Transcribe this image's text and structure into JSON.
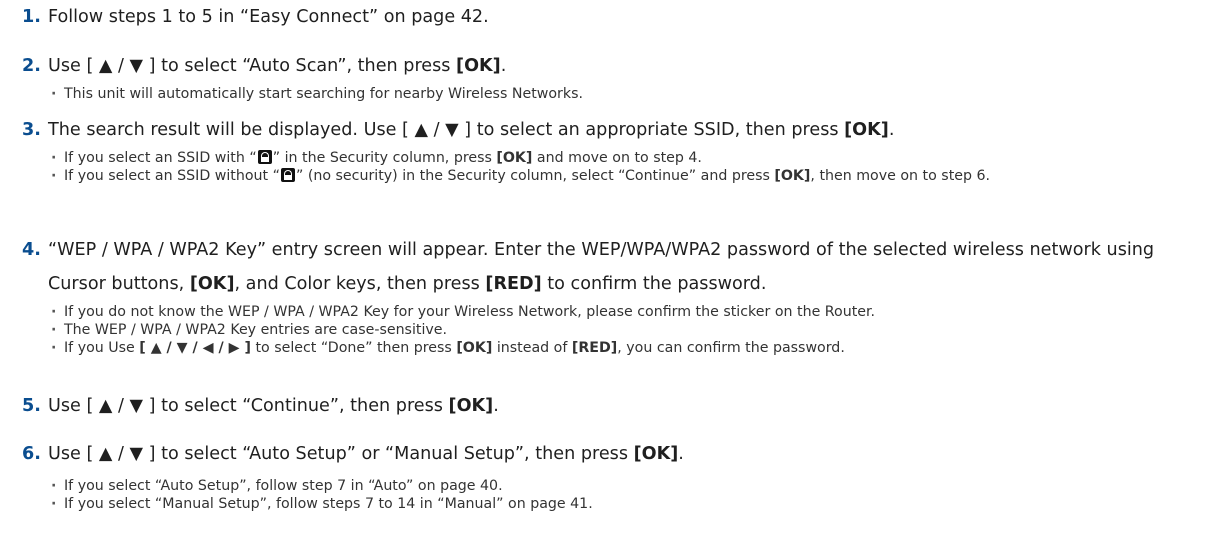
{
  "steps": [
    {
      "num": "1.",
      "text": "Follow steps 1 to 5 in “Easy Connect” on page 42."
    },
    {
      "num": "2.",
      "text_before": "Use [ ▲ / ▼ ] to select “Auto Scan”, then press ",
      "key": "[OK]",
      "text_after": ".",
      "bullets": [
        "This unit will automatically start searching for nearby Wireless Networks."
      ]
    },
    {
      "num": "3.",
      "text_before": "The search result will be displayed. Use [ ▲ / ▼ ] to select an appropriate SSID, then press ",
      "key": "[OK]",
      "text_after": ".",
      "bullets": [
        {
          "p1": "If you select an SSID with “",
          "p2": "” in the Security column, press ",
          "key": "[OK]",
          "p3": " and move on to step 4."
        },
        {
          "p1": "If you select an SSID without “",
          "p2": "” (no security) in the Security column, select “Continue” and press ",
          "key": "[OK]",
          "p3": ", then move on to step 6."
        }
      ]
    },
    {
      "num": "4.",
      "p1": "“WEP / WPA / WPA2 Key” entry screen will appear. Enter the WEP/WPA/WPA2 password of the selected wireless network using Cursor buttons, ",
      "key1": "[OK]",
      "p2": ", and Color keys, then press ",
      "key2": "[RED]",
      "p3": " to confirm the password.",
      "bullets": [
        "If you do not know the WEP / WPA / WPA2 Key for your Wireless Network, please confirm the sticker on the Router.",
        "The WEP / WPA / WPA2 Key entries are case-sensitive.",
        {
          "p1": "If you Use ",
          "key1": "[ ▲ / ▼ / ◀ / ▶ ]",
          "p2": " to select “Done” then press ",
          "key2": "[OK]",
          "p3": " instead of ",
          "key3": "[RED]",
          "p4": ", you can confirm the password."
        }
      ]
    },
    {
      "num": "5.",
      "text_before": "Use [ ▲ / ▼ ] to select “Continue”, then press ",
      "key": "[OK]",
      "text_after": "."
    },
    {
      "num": "6.",
      "text_before": "Use [ ▲ / ▼ ] to select “Auto Setup” or “Manual Setup”, then press ",
      "key": "[OK]",
      "text_after": ".",
      "bullets": [
        "If you select “Auto Setup”, follow step 7 in “Auto” on page 40.",
        "If you select “Manual Setup”, follow steps 7 to 14 in “Manual” on page 41."
      ]
    }
  ],
  "icons": {
    "security": "lock-icon"
  },
  "colors": {
    "step_number": "#0a4d8f"
  }
}
